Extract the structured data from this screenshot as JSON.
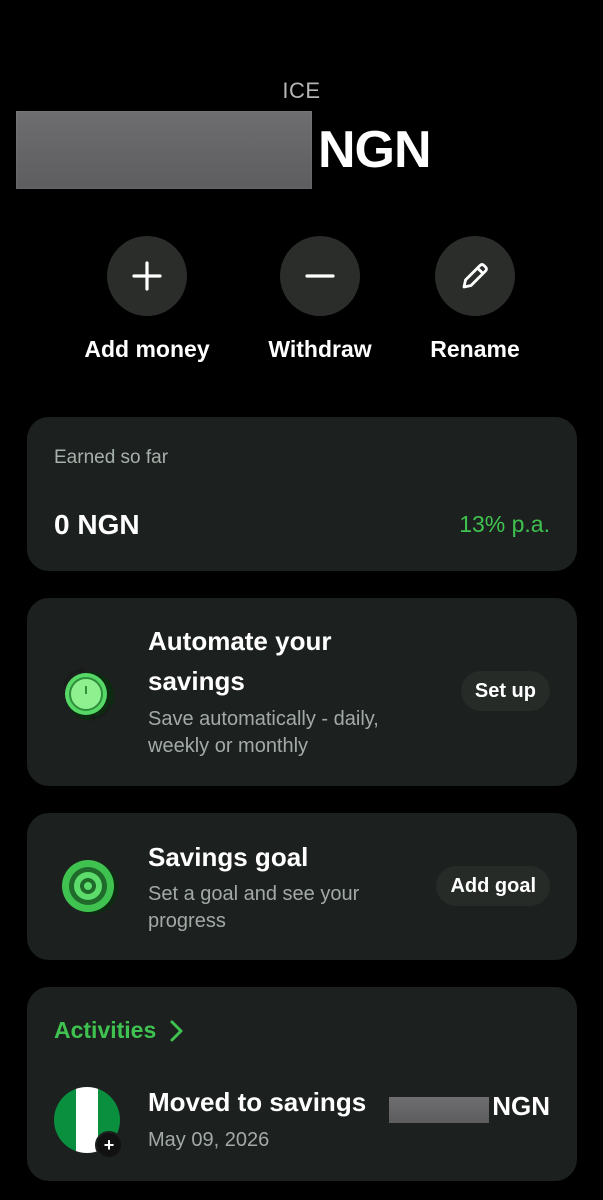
{
  "account": {
    "name": "ICE",
    "balance_currency": "NGN"
  },
  "actions": [
    {
      "label": "Add money",
      "icon": "plus-icon"
    },
    {
      "label": "Withdraw",
      "icon": "minus-icon"
    },
    {
      "label": "Rename",
      "icon": "pencil-icon"
    }
  ],
  "earned": {
    "label": "Earned so far",
    "value": "0 NGN",
    "rate": "13% p.a."
  },
  "automate": {
    "title_line1": "Automate your",
    "title_line2": "savings",
    "subtitle_line1": "Save automatically - daily,",
    "subtitle_line2": "weekly or monthly",
    "button": "Set up",
    "icon": "automate-clock-icon"
  },
  "goal": {
    "title": "Savings goal",
    "subtitle_line1": "Set a goal and see your",
    "subtitle_line2": "progress",
    "button": "Add goal",
    "icon": "target-icon"
  },
  "activities": {
    "heading": "Activities",
    "items": [
      {
        "title": "Moved to savings",
        "date": "May 09, 2026",
        "currency": "NGN",
        "icon": "nigeria-flag-icon"
      }
    ]
  },
  "colors": {
    "background": "#000000",
    "card": "#1c211f",
    "accent_green": "#3fc24f",
    "button_circle": "#2a2d2a"
  }
}
